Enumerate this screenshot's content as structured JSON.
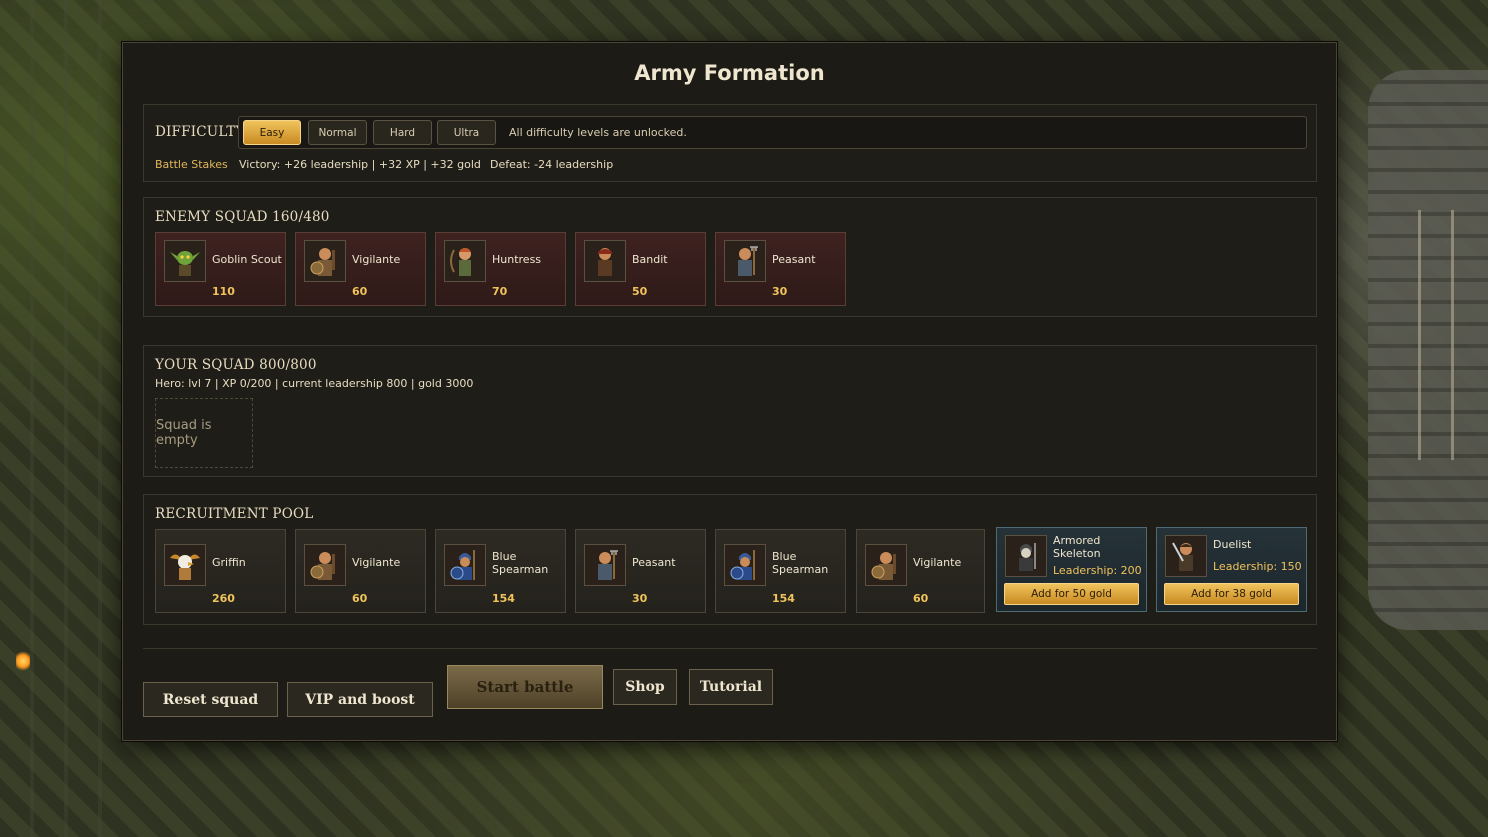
{
  "title": "Army Formation",
  "difficulty": {
    "label": "DIFFICULTY",
    "levels": [
      "Easy",
      "Normal",
      "Hard",
      "Ultra"
    ],
    "selected": "Easy",
    "note": "All difficulty levels are unlocked.",
    "stakes_label": "Battle Stakes",
    "victory": "Victory: +26 leadership | +32 XP | +32 gold",
    "defeat": "Defeat: -24 leadership"
  },
  "enemy": {
    "header": "ENEMY SQUAD 160/480",
    "units": [
      {
        "name": "Goblin Scout",
        "value": "110",
        "icon": "goblin-icon"
      },
      {
        "name": "Vigilante",
        "value": "60",
        "icon": "vigilante-icon"
      },
      {
        "name": "Huntress",
        "value": "70",
        "icon": "huntress-icon"
      },
      {
        "name": "Bandit",
        "value": "50",
        "icon": "bandit-icon"
      },
      {
        "name": "Peasant",
        "value": "30",
        "icon": "peasant-icon"
      }
    ]
  },
  "your_squad": {
    "header": "YOUR SQUAD 800/800",
    "hero": "Hero: lvl 7 | XP 0/200 | current leadership 800 | gold 3000",
    "empty_text": "Squad is empty"
  },
  "recruit": {
    "header": "RECRUITMENT POOL",
    "units": [
      {
        "name": "Griffin",
        "value": "260",
        "icon": "griffin-icon"
      },
      {
        "name": "Vigilante",
        "value": "60",
        "icon": "vigilante-icon"
      },
      {
        "name": "Blue Spearman",
        "value": "154",
        "icon": "spearman-icon"
      },
      {
        "name": "Peasant",
        "value": "30",
        "icon": "peasant-icon"
      },
      {
        "name": "Blue Spearman",
        "value": "154",
        "icon": "spearman-icon"
      },
      {
        "name": "Vigilante",
        "value": "60",
        "icon": "vigilante-icon"
      }
    ],
    "premium": [
      {
        "name": "Armored Skeleton",
        "leadership": "Leadership: 200",
        "buy": "Add for 50 gold",
        "icon": "skeleton-icon"
      },
      {
        "name": "Duelist",
        "leadership": "Leadership: 150",
        "buy": "Add for 38 gold",
        "icon": "duelist-icon"
      }
    ]
  },
  "actions": {
    "reset": "Reset squad",
    "vip": "VIP and boost",
    "start": "Start battle",
    "shop": "Shop",
    "tutorial": "Tutorial"
  },
  "colors": {
    "accent_gold": "#f0c35c",
    "enemy_card": "#3a1e1c",
    "premium_card": "#253238"
  }
}
